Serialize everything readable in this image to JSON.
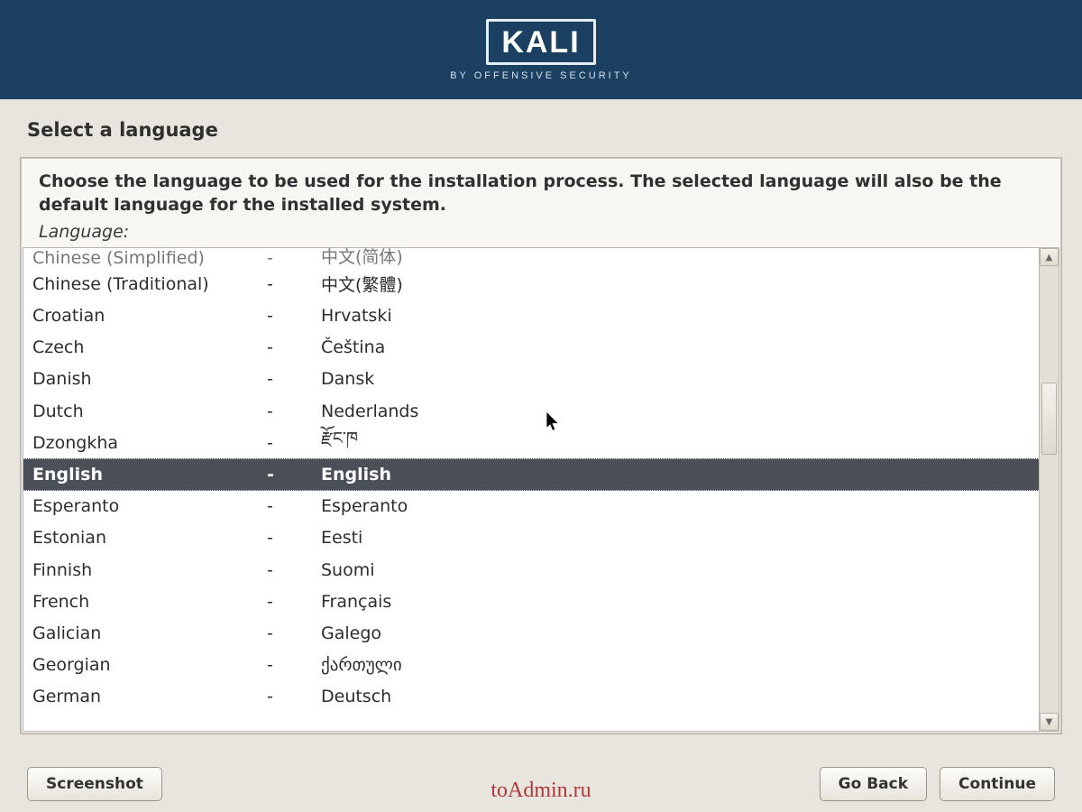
{
  "header": {
    "logo_text": "KALI",
    "logo_subtitle": "BY OFFENSIVE SECURITY"
  },
  "page": {
    "title": "Select a language",
    "instructions": "Choose the language to be used for the installation process. The selected language will also be the default language for the installed system.",
    "field_label": "Language:"
  },
  "languages": [
    {
      "english": "Chinese (Simplified)",
      "sep": "-",
      "native": "中文(简体)",
      "cutoff": true,
      "selected": false
    },
    {
      "english": "Chinese (Traditional)",
      "sep": "-",
      "native": "中文(繁體)",
      "cutoff": false,
      "selected": false
    },
    {
      "english": "Croatian",
      "sep": "-",
      "native": "Hrvatski",
      "cutoff": false,
      "selected": false
    },
    {
      "english": "Czech",
      "sep": "-",
      "native": "Čeština",
      "cutoff": false,
      "selected": false
    },
    {
      "english": "Danish",
      "sep": "-",
      "native": "Dansk",
      "cutoff": false,
      "selected": false
    },
    {
      "english": "Dutch",
      "sep": "-",
      "native": "Nederlands",
      "cutoff": false,
      "selected": false
    },
    {
      "english": "Dzongkha",
      "sep": "-",
      "native": "རྫོང་ཁ",
      "cutoff": false,
      "selected": false
    },
    {
      "english": "English",
      "sep": "-",
      "native": "English",
      "cutoff": false,
      "selected": true
    },
    {
      "english": "Esperanto",
      "sep": "-",
      "native": "Esperanto",
      "cutoff": false,
      "selected": false
    },
    {
      "english": "Estonian",
      "sep": "-",
      "native": "Eesti",
      "cutoff": false,
      "selected": false
    },
    {
      "english": "Finnish",
      "sep": "-",
      "native": "Suomi",
      "cutoff": false,
      "selected": false
    },
    {
      "english": "French",
      "sep": "-",
      "native": "Français",
      "cutoff": false,
      "selected": false
    },
    {
      "english": "Galician",
      "sep": "-",
      "native": "Galego",
      "cutoff": false,
      "selected": false
    },
    {
      "english": "Georgian",
      "sep": "-",
      "native": "ქართული",
      "cutoff": false,
      "selected": false
    },
    {
      "english": "German",
      "sep": "-",
      "native": "Deutsch",
      "cutoff": false,
      "selected": false
    }
  ],
  "buttons": {
    "screenshot": "Screenshot",
    "go_back": "Go Back",
    "continue": "Continue"
  },
  "watermark": "toAdmin.ru",
  "colors": {
    "header_bg": "#1b4061",
    "panel_bg": "#f7f6f3",
    "selected_bg": "#4a4f58"
  }
}
